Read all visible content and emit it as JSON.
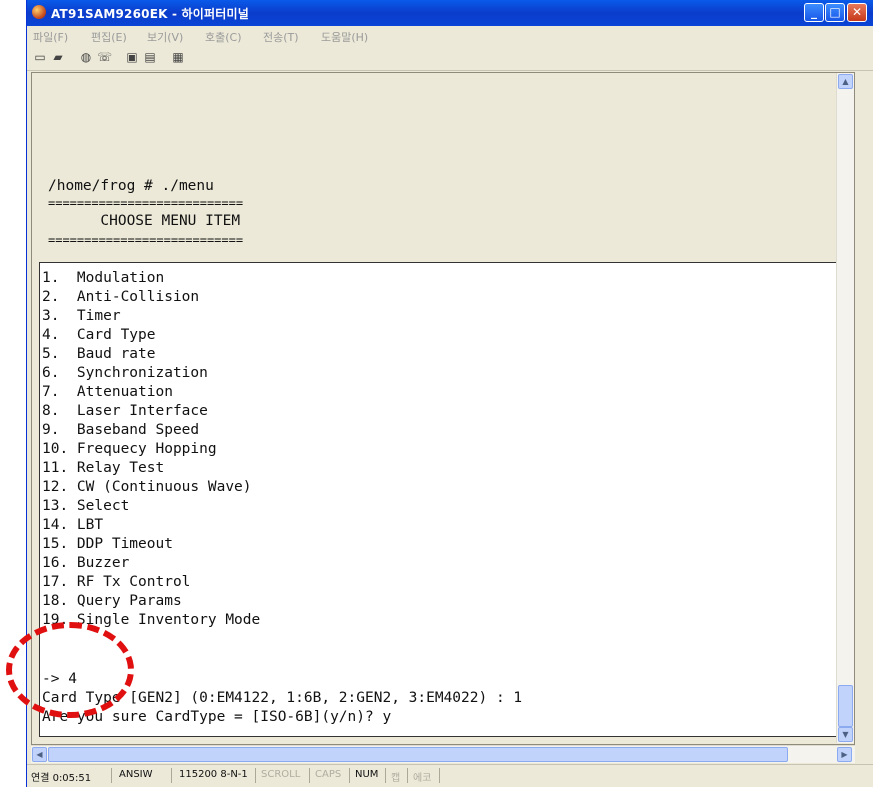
{
  "window": {
    "title": "AT91SAM9260EK - 하이퍼터미널",
    "controls": [
      "_",
      "□",
      "✕"
    ]
  },
  "menu": [
    "파일(F)",
    "편집(E)",
    "보기(V)",
    "호출(C)",
    "전송(T)",
    "도움말(H)"
  ],
  "toolbar": [
    "new-icon",
    "open-icon",
    "disconnect-icon",
    "connect-icon",
    "send-icon",
    "receive-icon",
    "properties-icon"
  ],
  "terminal": {
    "prompt": "/home/frog # ./menu",
    "rule1": "===========================",
    "heading": "      CHOOSE MENU ITEM",
    "rule2": "===========================",
    "items": [
      "1.  Modulation",
      "2.  Anti-Collision",
      "3.  Timer",
      "4.  Card Type",
      "5.  Baud rate",
      "6.  Synchronization",
      "7.  Attenuation",
      "8.  Laser Interface",
      "9.  Baseband Speed",
      "10. Frequecy Hopping",
      "11. Relay Test",
      "12. CW (Continuous Wave)",
      "13. Select",
      "14. LBT",
      "15. DDP Timeout",
      "16. Buzzer",
      "17. RF Tx Control",
      "18. Query Params",
      "19. Single Inventory Mode"
    ],
    "input_line": "-> 4",
    "card_type_line": "Card Type [GEN2] (0:EM4122, 1:6B, 2:GEN2, 3:EM4022) : 1",
    "confirm_line": "Are you sure CardType = [ISO-6B](y/n)? y"
  },
  "status": {
    "connected": "연결 0:05:51",
    "emulation": "ANSIW",
    "port": "115200 8-N-1",
    "scroll": "SCROLL",
    "caps": "CAPS",
    "num": "NUM",
    "cap_kr": "캡",
    "echo": "에코"
  },
  "colors": {
    "title_bar": "#0a5ae9",
    "annotation": "#e01010"
  }
}
